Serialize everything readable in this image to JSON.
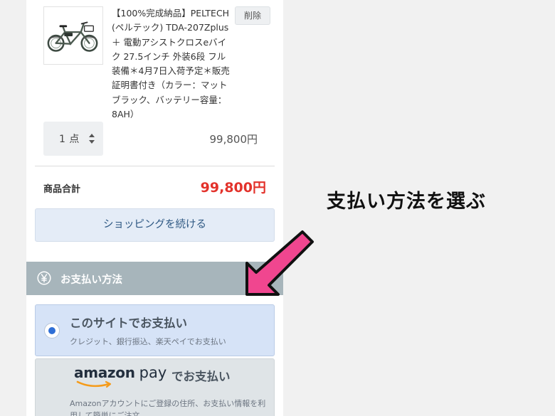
{
  "cart": {
    "item": {
      "title": "【100%完成納品】PELTECH (ペルテック) TDA-207Zplus ＋ 電動アシストクロスeバイク 27.5インチ 外装6段 フル装備＊4月7日入荷予定＊販売証明書付き（カラー：マットブラック、バッテリー容量：8AH）",
      "delete_label": "削除",
      "quantity_label": "1 点",
      "price": "99,800円",
      "image_icon": "bicycle-icon"
    },
    "subtotal_label": "商品合計",
    "subtotal_value": "99,800円",
    "continue_label": "ショッピングを続ける"
  },
  "payment": {
    "header_icon": "yen-icon",
    "header_title": "お支払い方法",
    "options": [
      {
        "title": "このサイトでお支払い",
        "description": "クレジット、銀行振込、楽天ペイでお支払い",
        "selected": true
      },
      {
        "logo_amazon": "amazon",
        "logo_pay": "pay",
        "title": "でお支払い",
        "description": "Amazonアカウントにご登録の住所、お支払い情報を利用して簡単にご注文",
        "selected": false
      }
    ]
  },
  "annotation": {
    "text": "支払い方法を選ぶ",
    "arrow_color": "#f0468f"
  },
  "colors": {
    "accent_red": "#e3322b",
    "header_gray": "#a7b5bb",
    "selected_option": "#d6e3f7",
    "radio_blue": "#2f6fd6"
  }
}
